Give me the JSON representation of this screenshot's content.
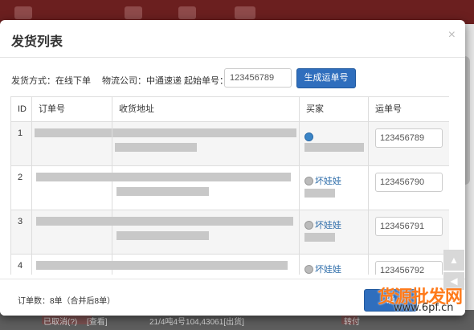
{
  "background": {
    "footer_snippets": [
      "已取消(?)",
      "[查看]",
      "21/4吨4号104,43061[出货]",
      "转付"
    ]
  },
  "dialog": {
    "title": "发货列表",
    "close_glyph": "×"
  },
  "toolbar": {
    "shipping_method": "发货方式：在线下单",
    "logistics_company": "物流公司：中通速递",
    "start_number_label": "起始单号：",
    "start_number_value": "123456789",
    "generate_button": "生成运单号"
  },
  "table": {
    "headers": [
      "ID",
      "订单号",
      "收货地址",
      "买家",
      "运单号"
    ],
    "rows": [
      {
        "id": "1",
        "buyer": "",
        "tracking": "123456789"
      },
      {
        "id": "2",
        "buyer": "坏娃娃",
        "tracking": "123456790"
      },
      {
        "id": "3",
        "buyer": "坏娃娃",
        "tracking": "123456791"
      },
      {
        "id": "4",
        "buyer": "坏娃娃",
        "tracking": "123456792"
      }
    ]
  },
  "footer": {
    "order_count": "订单数：8单（合并后8单）",
    "confirm_button": "确"
  },
  "float_buttons": {
    "up_glyph": "▲",
    "left_glyph": "◀"
  },
  "watermark": {
    "line1": "货源批发网",
    "line2": "www.6pf.cn"
  },
  "colors": {
    "primary": "#2f6ebd",
    "link": "#2a6aa8",
    "header_bg": "#6b1f1f"
  }
}
